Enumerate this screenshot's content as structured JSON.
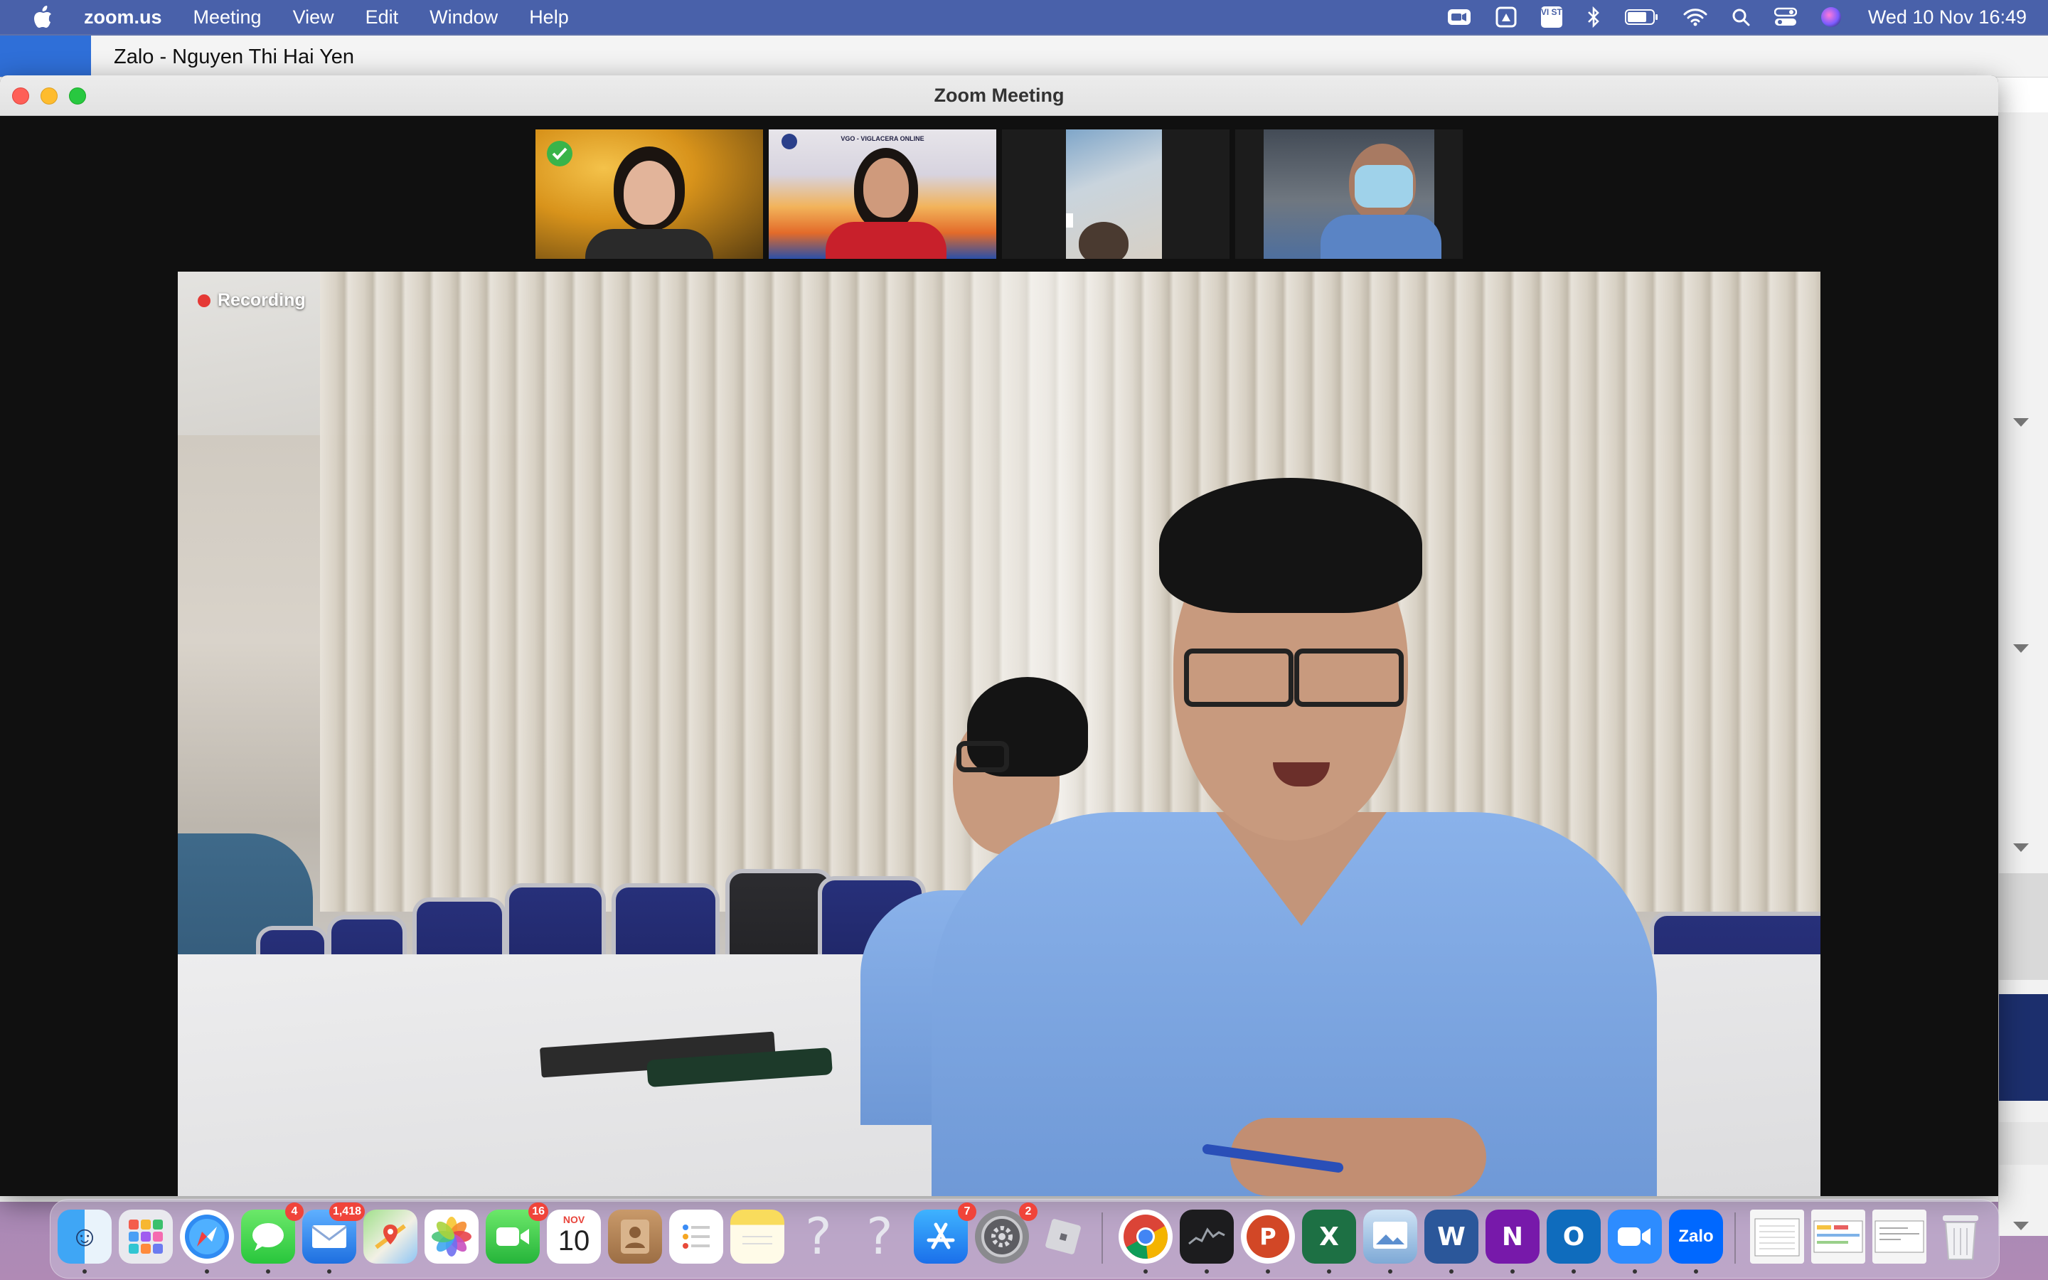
{
  "menubar": {
    "app_name": "zoom.us",
    "menus": [
      "Meeting",
      "View",
      "Edit",
      "Window",
      "Help"
    ],
    "clock": "Wed 10 Nov  16:49",
    "status_icons": [
      "zoom-camera-icon",
      "drive-icon",
      "vi-st-input-icon",
      "bluetooth-icon",
      "battery-icon",
      "wifi-icon",
      "spotlight-search-icon",
      "control-center-icon",
      "siri-icon"
    ],
    "input_source_label": "VI ST"
  },
  "zalo": {
    "window_title": "Zalo - Nguyen Thi Hai Yen"
  },
  "zoom": {
    "window_title": "Zoom Meeting",
    "recording_label": "Recording",
    "thumbnails": [
      {
        "name": "participant-1",
        "speaking_check": true
      },
      {
        "name": "participant-2",
        "banner": "VGO - VIGLACERA ONLINE"
      },
      {
        "name": "participant-3"
      },
      {
        "name": "participant-4"
      }
    ]
  },
  "dock": {
    "items": [
      {
        "name": "finder",
        "icon": "finder-icon",
        "badge": null,
        "running": true
      },
      {
        "name": "launchpad",
        "icon": "launchpad-icon",
        "badge": null,
        "running": false
      },
      {
        "name": "safari",
        "icon": "safari-icon",
        "badge": null,
        "running": true
      },
      {
        "name": "messages",
        "icon": "messages-icon",
        "badge": "4",
        "running": true
      },
      {
        "name": "mail",
        "icon": "mail-icon",
        "badge": "1,418",
        "running": true
      },
      {
        "name": "maps",
        "icon": "maps-icon",
        "badge": null,
        "running": false
      },
      {
        "name": "photos",
        "icon": "photos-icon",
        "badge": null,
        "running": false
      },
      {
        "name": "facetime",
        "icon": "facetime-icon",
        "badge": "16",
        "running": false
      },
      {
        "name": "calendar",
        "icon": "calendar-icon",
        "badge": null,
        "running": false,
        "month": "NOV",
        "day": "10"
      },
      {
        "name": "contacts",
        "icon": "contacts-icon",
        "badge": null,
        "running": false
      },
      {
        "name": "reminders",
        "icon": "reminders-icon",
        "badge": null,
        "running": false
      },
      {
        "name": "notes",
        "icon": "notes-icon",
        "badge": null,
        "running": false
      },
      {
        "name": "unknown-1",
        "icon": "question-icon",
        "badge": null,
        "running": false,
        "glyph": "?"
      },
      {
        "name": "unknown-2",
        "icon": "question-icon",
        "badge": null,
        "running": false,
        "glyph": "?"
      },
      {
        "name": "app-store",
        "icon": "app-store-icon",
        "badge": "7",
        "running": false
      },
      {
        "name": "system-preferences",
        "icon": "system-preferences-icon",
        "badge": "2",
        "running": false
      },
      {
        "name": "roblox",
        "icon": "roblox-icon",
        "badge": null,
        "running": false
      },
      {
        "name": "chrome",
        "icon": "chrome-icon",
        "badge": null,
        "running": true
      },
      {
        "name": "stocks",
        "icon": "stocks-icon",
        "badge": null,
        "running": true
      },
      {
        "name": "powerpoint",
        "icon": "powerpoint-icon",
        "badge": null,
        "running": true,
        "glyph": "P"
      },
      {
        "name": "excel",
        "icon": "excel-icon",
        "badge": null,
        "running": true,
        "glyph": "X"
      },
      {
        "name": "preview",
        "icon": "preview-icon",
        "badge": null,
        "running": true
      },
      {
        "name": "word",
        "icon": "word-icon",
        "badge": null,
        "running": true,
        "glyph": "W"
      },
      {
        "name": "onenote",
        "icon": "onenote-icon",
        "badge": null,
        "running": true,
        "glyph": "N"
      },
      {
        "name": "outlook",
        "icon": "outlook-icon",
        "badge": null,
        "running": true,
        "glyph": "O"
      },
      {
        "name": "zoom",
        "icon": "zoom-app-icon",
        "badge": null,
        "running": true
      },
      {
        "name": "zalo",
        "icon": "zalo-icon",
        "badge": null,
        "running": true,
        "glyph": "Zalo"
      },
      {
        "name": "recent-doc-1",
        "icon": "document-thumbnail-icon",
        "badge": null,
        "running": false
      },
      {
        "name": "recent-doc-2",
        "icon": "document-thumbnail-icon",
        "badge": null,
        "running": false
      },
      {
        "name": "recent-doc-3",
        "icon": "document-thumbnail-icon",
        "badge": null,
        "running": false
      },
      {
        "name": "trash",
        "icon": "trash-icon",
        "badge": null,
        "running": false
      }
    ]
  }
}
